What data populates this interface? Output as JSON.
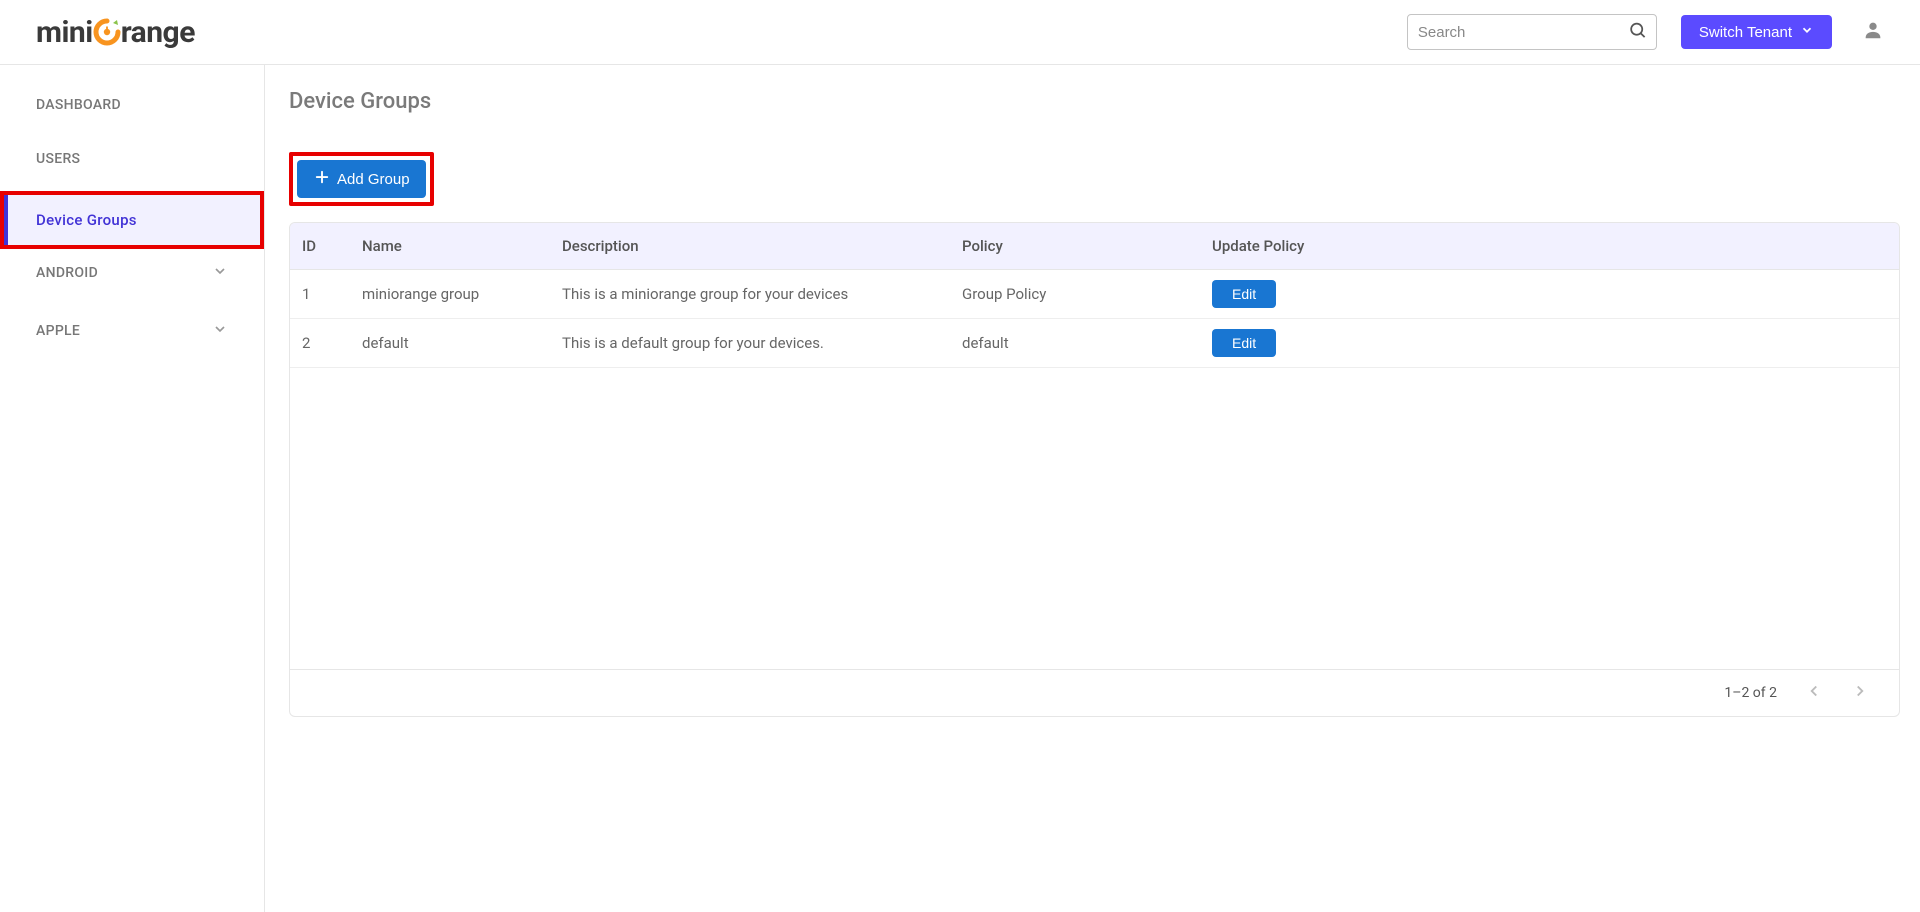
{
  "header": {
    "search_placeholder": "Search",
    "switch_tenant_label": "Switch Tenant"
  },
  "sidebar": {
    "items": [
      {
        "label": "DASHBOARD",
        "active": false,
        "expandable": false
      },
      {
        "label": "USERS",
        "active": false,
        "expandable": false
      },
      {
        "label": "Device Groups",
        "active": true,
        "expandable": false
      },
      {
        "label": "ANDROID",
        "active": false,
        "expandable": true
      },
      {
        "label": "APPLE",
        "active": false,
        "expandable": true
      }
    ]
  },
  "page": {
    "title": "Device Groups",
    "add_button_label": "Add Group"
  },
  "table": {
    "columns": {
      "id": "ID",
      "name": "Name",
      "description": "Description",
      "policy": "Policy",
      "update_policy": "Update Policy"
    },
    "rows": [
      {
        "id": "1",
        "name": "miniorange group",
        "description": "This is a miniorange group for your devices",
        "policy": "Group Policy",
        "edit_label": "Edit"
      },
      {
        "id": "2",
        "name": "default",
        "description": "This is a default group for your devices.",
        "policy": "default",
        "edit_label": "Edit"
      }
    ]
  },
  "pagination": {
    "range": "1–2 of 2"
  }
}
